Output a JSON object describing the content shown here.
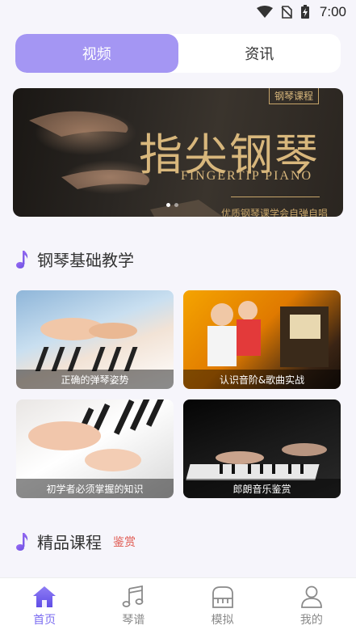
{
  "status_bar": {
    "time": "7:00",
    "icons": [
      "wifi-icon",
      "no-sim-icon",
      "battery-charging-icon"
    ]
  },
  "tabs": [
    {
      "label": "视频",
      "active": true
    },
    {
      "label": "资讯",
      "active": false
    }
  ],
  "banner": {
    "tag": "钢琴课程",
    "title": "指尖钢琴",
    "subtitle": "FINGERTIP PIANO",
    "slogan": "优质钢琴课学会自弹自唱",
    "dots": 2,
    "active_dot": 1
  },
  "section_basic": {
    "icon": "music-note-icon",
    "title": "钢琴基础教学"
  },
  "cards": [
    {
      "caption": "正确的弹琴姿势"
    },
    {
      "caption": "认识音阶&歌曲实战"
    },
    {
      "caption": "初学者必须掌握的知识"
    },
    {
      "caption": "郎朗音乐鉴赏"
    }
  ],
  "section_premium": {
    "icon": "music-note-icon",
    "title": "精品课程",
    "subtitle": "鉴赏"
  },
  "bottom_nav": [
    {
      "label": "首页",
      "icon": "home-icon",
      "active": true
    },
    {
      "label": "琴谱",
      "icon": "music-score-icon",
      "active": false
    },
    {
      "label": "模拟",
      "icon": "piano-icon",
      "active": false
    },
    {
      "label": "我的",
      "icon": "user-icon",
      "active": false
    }
  ],
  "colors": {
    "accent": "#a496f3",
    "nav_active": "#7b6cf0",
    "banner_gold": "#d8b77c",
    "subtitle_red": "#e0584f"
  }
}
